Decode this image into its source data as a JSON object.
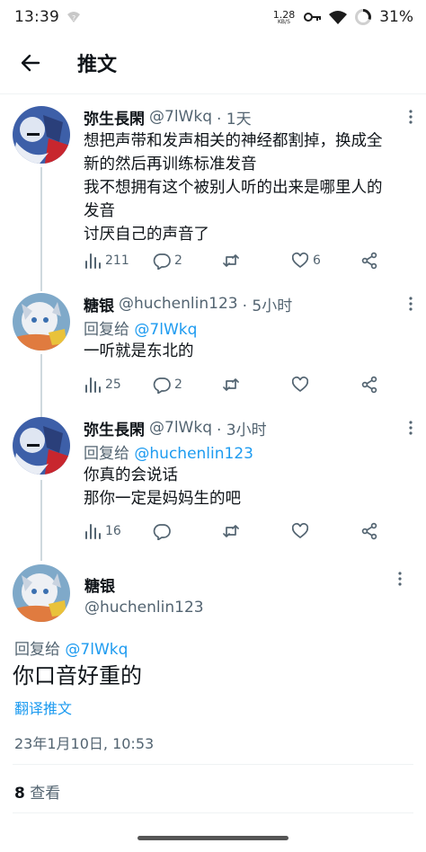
{
  "status_bar": {
    "time": "13:39",
    "net_speed": "1.28",
    "net_unit": "KB/S",
    "battery": "31%"
  },
  "header": {
    "title": "推文"
  },
  "thread": [
    {
      "name": "弥生長閑",
      "handle": "@7lWkq",
      "time": "· 1天",
      "reply_label": "",
      "reply_mention": "",
      "lines": [
        "想把声带和发声相关的神经都割掉，换成全",
        "新的然后再训练标准发音",
        "我不想拥有这个被别人听的出来是哪里人的",
        "发音",
        "讨厌自己的声音了"
      ],
      "views": "211",
      "replies": "2",
      "retweets": "",
      "likes": "6"
    },
    {
      "name": "糖银",
      "handle": "@huchenlin123",
      "time": "· 5小时",
      "reply_label": "回复给",
      "reply_mention": "@7lWkq",
      "lines": [
        "一听就是东北的"
      ],
      "views": "25",
      "replies": "2",
      "retweets": "",
      "likes": ""
    },
    {
      "name": "弥生長閑",
      "handle": "@7lWkq",
      "time": "· 3小时",
      "reply_label": "回复给",
      "reply_mention": "@huchenlin123",
      "lines": [
        "你真的会说话",
        "那你一定是妈妈生的吧"
      ],
      "views": "16",
      "replies": "",
      "retweets": "",
      "likes": ""
    }
  ],
  "main_tweet": {
    "name": "糖银",
    "handle": "@huchenlin123",
    "reply_label": "回复给",
    "reply_mention": "@7lWkq",
    "text": "你口音好重的",
    "translate_label": "翻译推文",
    "timestamp": "23年1月10日, 10:53",
    "views_count": "8",
    "views_label": "查看"
  },
  "colors": {
    "accent": "#1d9bf0",
    "secondary_text": "#536471",
    "primary_text": "#0f1419",
    "thread_line": "#cfd9de"
  }
}
